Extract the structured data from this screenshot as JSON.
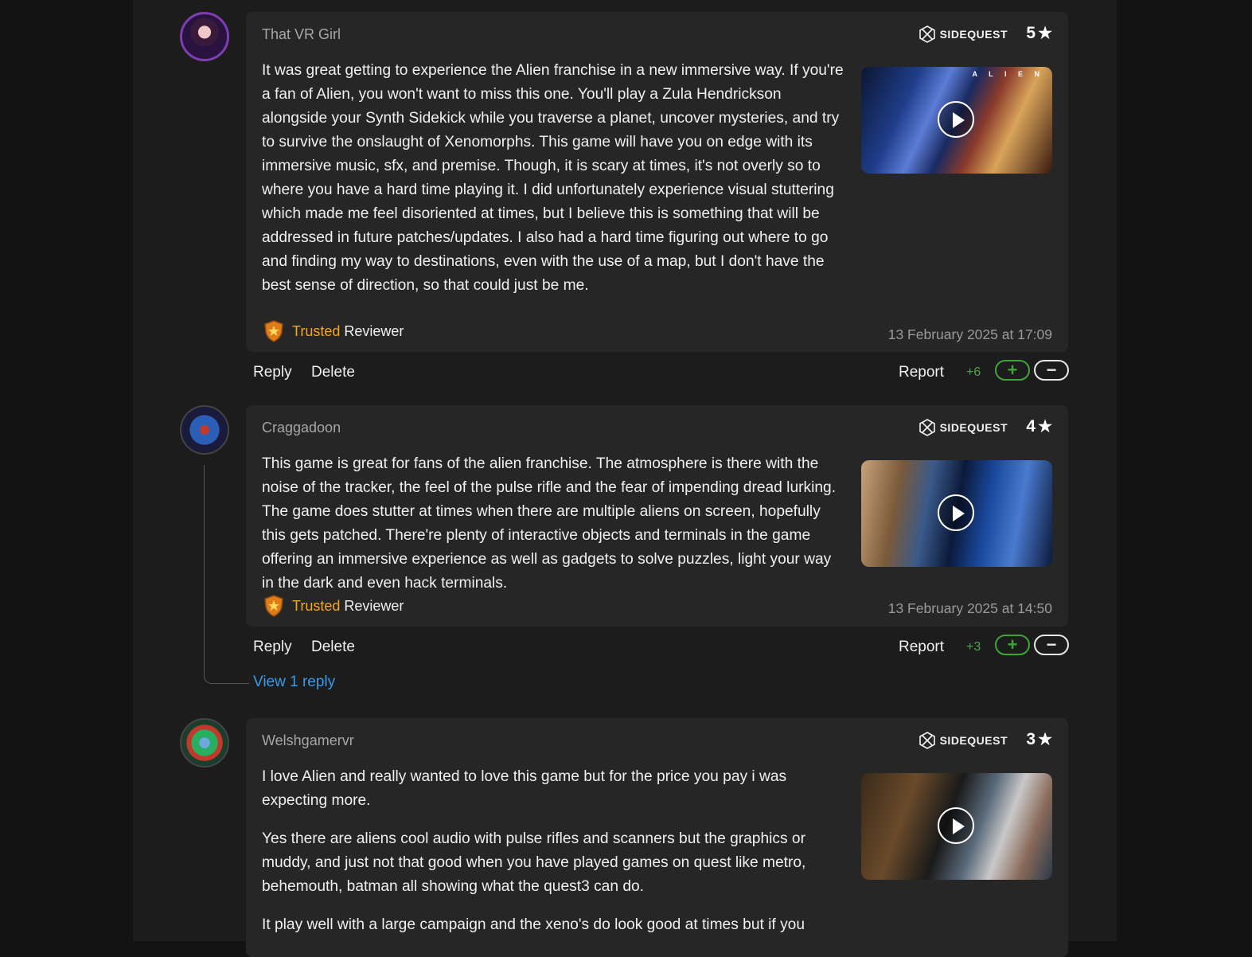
{
  "reviews": [
    {
      "username": "That VR Girl",
      "brand": "SIDEQUEST",
      "rating": "5",
      "paragraphs": [
        "It was great getting to experience the Alien franchise in a new immersive way. If you're a fan of Alien, you won't want to miss this one. You'll play a Zula Hendrickson alongside your Synth Sidekick while you traverse a planet, uncover mysteries, and try to survive the onslaught of Xenomorphs. This game will have you on edge with its immersive music, sfx, and premise. Though, it is scary at times, it's not overly so to where you have a hard time playing it. I did unfortunately experience visual stuttering which made me feel disoriented at times, but I believe this is something that will be addressed in future patches/updates. I also had a hard time figuring out where to go and finding my way to destinations, even with the use of a map, but I don't have the best sense of direction, so that could just be me."
      ],
      "thumbnail_label": "A L I E N",
      "trusted_word": "Trusted",
      "reviewer_word": "Reviewer",
      "date": "13 February 2025 at 17:09",
      "reply_label": "Reply",
      "delete_label": "Delete",
      "report_label": "Report",
      "score": "+6",
      "upvote_symbol": "+",
      "downvote_symbol": "−"
    },
    {
      "username": "Craggadoon",
      "brand": "SIDEQUEST",
      "rating": "4",
      "paragraphs": [
        "This game is great for fans of the alien franchise. The atmosphere is there with the noise of the tracker, the feel of the pulse rifle and the fear of impending dread lurking. The game does stutter at times when there are multiple aliens on screen, hopefully this gets patched. There're plenty of interactive objects and terminals in the game offering an immersive experience as well as gadgets to solve puzzles, light your way in the dark and even hack terminals."
      ],
      "trusted_word": "Trusted",
      "reviewer_word": "Reviewer",
      "date": "13 February 2025 at 14:50",
      "reply_label": "Reply",
      "delete_label": "Delete",
      "report_label": "Report",
      "score": "+3",
      "upvote_symbol": "+",
      "downvote_symbol": "−",
      "view_replies_label": "View 1 reply"
    },
    {
      "username": "Welshgamervr",
      "brand": "SIDEQUEST",
      "rating": "3",
      "paragraphs": [
        "I love Alien and really wanted to love this game but for the price you pay i was expecting more.",
        "Yes there are aliens cool audio with pulse rifles and scanners but the graphics or muddy, and just not that good when you have played games on quest like metro, behemouth, batman all showing what the quest3 can do.",
        "It play well with a large campaign and the xeno's do look good at times but if you"
      ]
    }
  ],
  "icons": {
    "brand_logo": "sidequest-logo-icon",
    "star": "star-icon",
    "shield": "trusted-shield-icon",
    "play": "play-icon"
  },
  "colors": {
    "trusted": "#f5a623",
    "score": "#4ea34b",
    "link": "#3a9ae8"
  }
}
